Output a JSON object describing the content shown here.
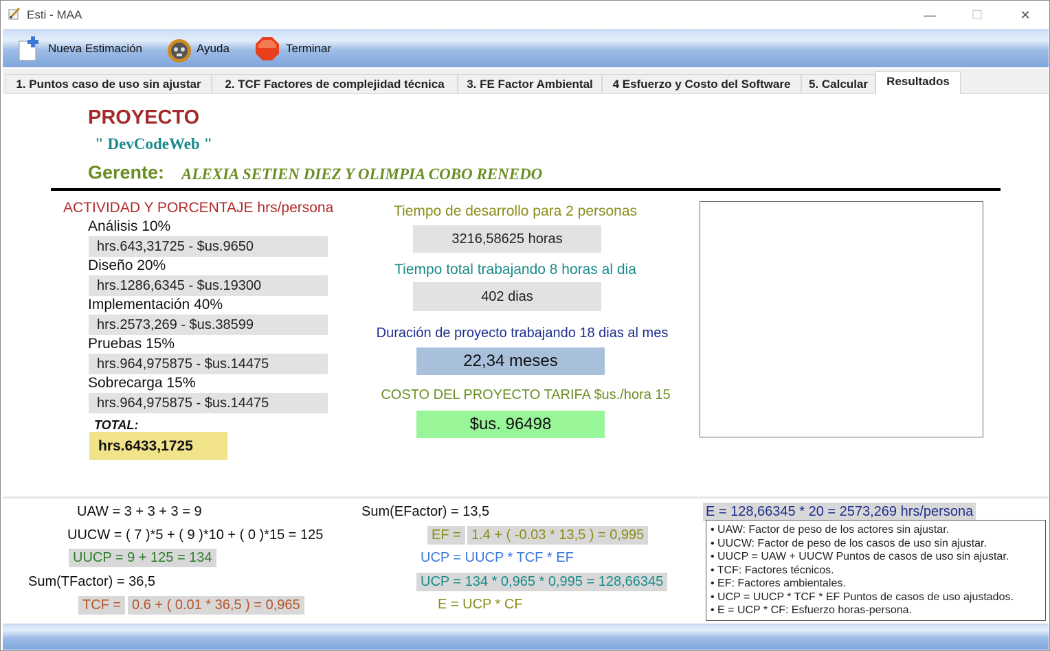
{
  "window": {
    "title": "Esti - MAA",
    "minimize": "—",
    "maximize": "☐",
    "close": "✕"
  },
  "toolbar": {
    "new_label": "Nueva Estimación",
    "help_label": "Ayuda",
    "quit_label": "Terminar"
  },
  "tabs": [
    {
      "label": "1. Puntos caso de uso sin ajustar"
    },
    {
      "label": "2. TCF Factores de complejidad técnica"
    },
    {
      "label": "3. FE Factor Ambiental"
    },
    {
      "label": "4 Esfuerzo y Costo del Software"
    },
    {
      "label": "5. Calcular"
    },
    {
      "label": "Resultados"
    }
  ],
  "header": {
    "project_heading": "PROYECTO",
    "project_name": "\" DevCodeWeb \"",
    "manager_label": "Gerente:",
    "manager_name": "ALEXIA SETIEN DIEZ Y OLIMPIA COBO RENEDO"
  },
  "activities": {
    "heading": "ACTIVIDAD Y PORCENTAJE hrs/persona",
    "items": [
      {
        "label": "Análisis 10%",
        "value": "hrs.643,31725 - $us.9650"
      },
      {
        "label": "Diseño 20%",
        "value": "hrs.1286,6345 - $us.19300"
      },
      {
        "label": "Implementación 40%",
        "value": "hrs.2573,269 - $us.38599"
      },
      {
        "label": "Pruebas 15%",
        "value": "hrs.964,975875 - $us.14475"
      },
      {
        "label": "Sobrecarga 15%",
        "value": "hrs.964,975875 - $us.14475"
      }
    ],
    "total_label": "TOTAL:",
    "total_value": "hrs.6433,1725"
  },
  "summary": {
    "dev_time_label": "Tiempo de desarrollo para 2 personas",
    "dev_time_value": "3216,58625 horas",
    "total_time_label": "Tiempo total trabajando 8 horas al dia",
    "total_time_value": "402 dias",
    "duration_label": "Duración de proyecto trabajando 18 dias al mes",
    "duration_value": "22,34 meses",
    "cost_label": "COSTO DEL PROYECTO TARIFA $us./hora 15",
    "cost_value": "$us. 96498"
  },
  "formulas": {
    "uaw": "UAW =  3 + 3 + 3  = 9",
    "uucw": "UUCW =  ( 7 )*5 + ( 9 )*10 + ( 0 )*15 = 125",
    "uucp": "UUCP =  9 + 125 = 134",
    "sum_tfactor": "Sum(TFactor) = 36,5",
    "tcf_label": "TCF = ",
    "tcf_value": "0.6 + ( 0.01 * 36,5 ) = 0,965",
    "sum_efactor": "Sum(EFactor) =  13,5",
    "ef_label": "EF = ",
    "ef_value": "1.4 + ( -0.03 * 13,5 ) = 0,995",
    "ucp_def": "UCP = UUCP * TCF * EF",
    "ucp_value": "UCP = 134 * 0,965 * 0,995 = 128,66345",
    "e_def": "E = UCP * CF",
    "e_value": "E = 128,66345 * 20 = 2573,269 hrs/persona"
  },
  "legend": [
    "• UAW: Factor de peso de los actores sin ajustar.",
    "• UUCW: Factor de peso de los casos de uso sin ajustar.",
    "• UUCP = UAW + UUCW Puntos de casos de uso sin ajustar.",
    "• TCF: Factores técnicos.",
    "• EF: Factores ambientales.",
    "• UCP = UUCP * TCF * EF Puntos de casos de uso ajustados.",
    "• E = UCP * CF: Esfuerzo horas-persona."
  ],
  "colors": {
    "project_red": "#a52a2a",
    "teal": "#1a8a8a",
    "olive": "#6b8e23",
    "navy": "#1f2f8f",
    "total_yellow": "#f0e38a",
    "duration_blue": "#a9c0dd",
    "cost_green": "#98f598"
  }
}
